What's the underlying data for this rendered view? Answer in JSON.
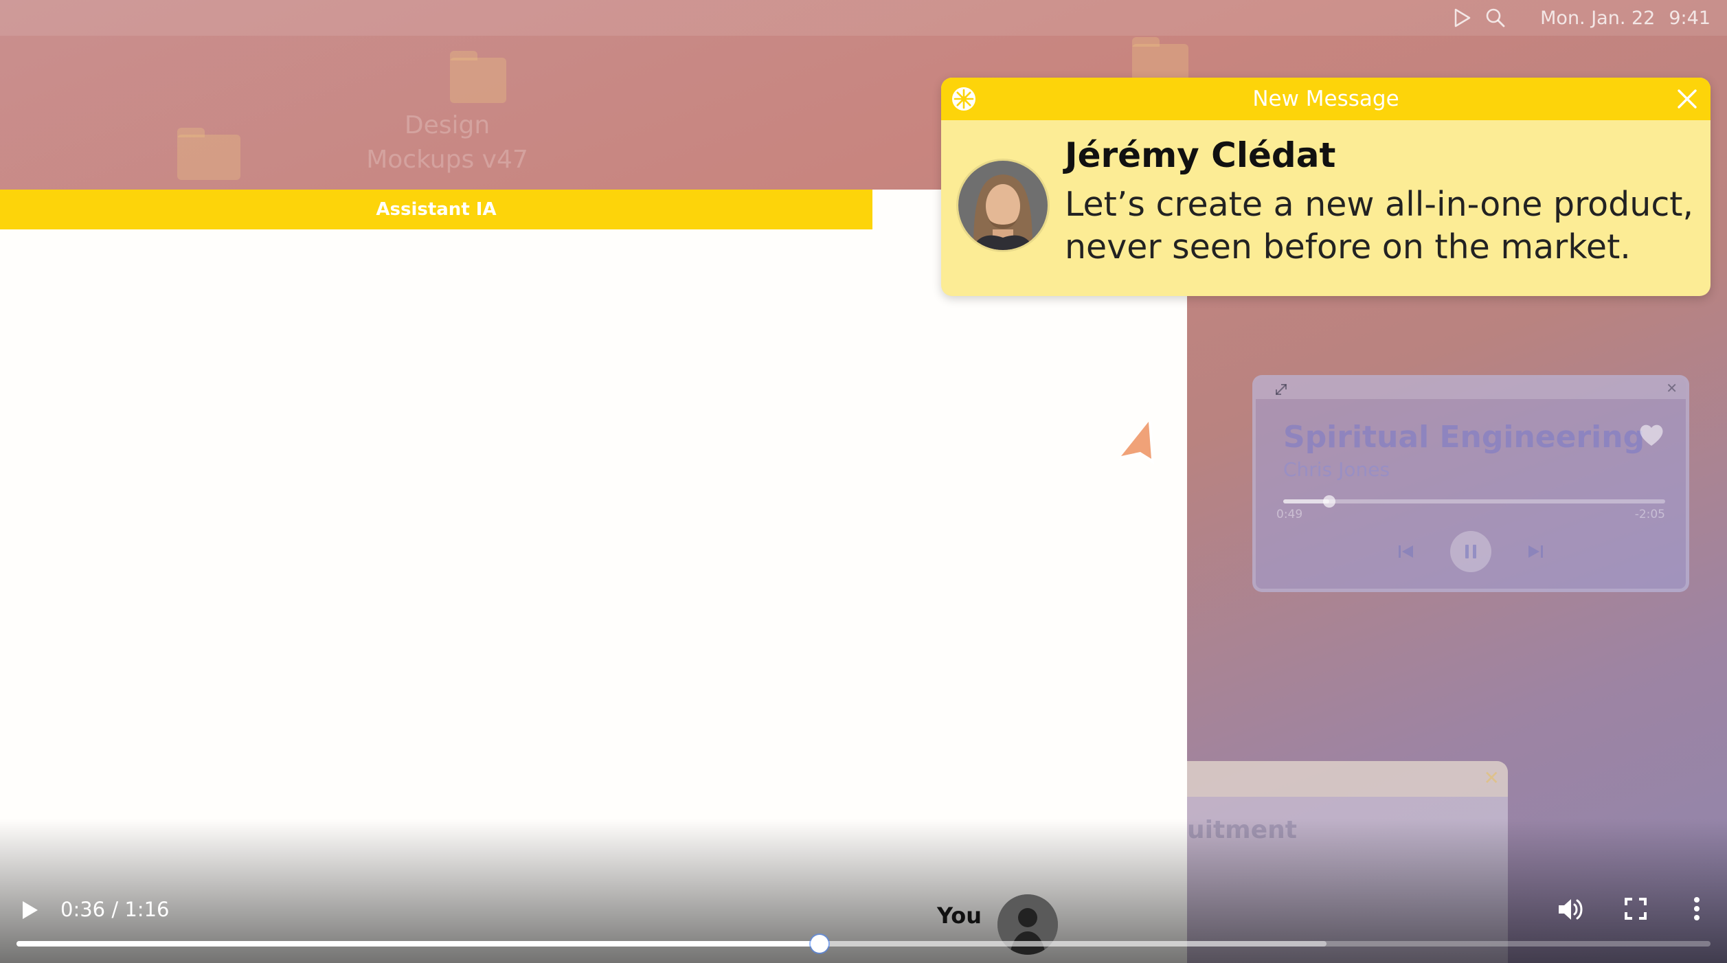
{
  "menubar": {
    "date": "Mon. Jan. 22",
    "time": "9:41",
    "icons": [
      "play-icon",
      "search-icon"
    ]
  },
  "desktop": {
    "folders": [
      {
        "label": "Design Mockups v47"
      },
      {
        "label": ""
      },
      {
        "label": ""
      }
    ]
  },
  "assistant": {
    "title": "Assistant IA"
  },
  "notification": {
    "title": "New Message",
    "sender": "Jérémy Clédat",
    "message": "Let’s create a new all-in-one product, never seen before on the market.",
    "accent": "#fdd40a",
    "background": "#fcec95"
  },
  "music": {
    "song": "Spiritual Engineering",
    "artist": "Chris Jones",
    "elapsed": "0:49",
    "remaining": "-2:05",
    "progress_fraction": 0.12
  },
  "card": {
    "text_fragment": "uitment"
  },
  "video": {
    "current_time": "0:36",
    "duration": "1:16",
    "time_separator": " / ",
    "speaker": "You",
    "played_fraction": 0.4742,
    "buffered_fraction": 0.7733
  }
}
